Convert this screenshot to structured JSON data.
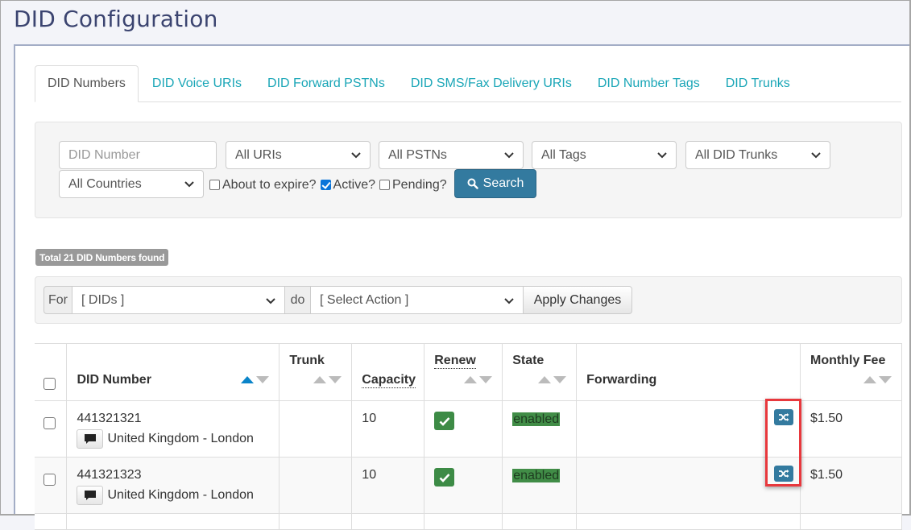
{
  "page": {
    "title": "DID Configuration"
  },
  "tabs": [
    {
      "label": "DID Numbers",
      "active": true
    },
    {
      "label": "DID Voice URIs",
      "active": false
    },
    {
      "label": "DID Forward PSTNs",
      "active": false
    },
    {
      "label": "DID SMS/Fax Delivery URIs",
      "active": false
    },
    {
      "label": "DID Number Tags",
      "active": false
    },
    {
      "label": "DID Trunks",
      "active": false
    }
  ],
  "filters": {
    "did_number_placeholder": "DID Number",
    "uris_selected": "All URIs",
    "pstns_selected": "All PSTNs",
    "tags_selected": "All Tags",
    "trunks_selected": "All DID Trunks",
    "countries_selected": "All Countries",
    "about_to_expire": {
      "label": "About to expire?",
      "checked": false
    },
    "active": {
      "label": "Active?",
      "checked": true
    },
    "pending": {
      "label": "Pending?",
      "checked": false
    },
    "search_label": "Search"
  },
  "summary": {
    "total_badge": "Total 21 DID Numbers found"
  },
  "bulk_action": {
    "for_label": "For",
    "target_selected": "[ DIDs ]",
    "do_label": "do",
    "action_selected": "[ Select Action ]",
    "apply_label": "Apply Changes"
  },
  "table": {
    "headers": {
      "did_number": "DID Number",
      "trunk": "Trunk",
      "capacity": "Capacity",
      "renew": "Renew",
      "state": "State",
      "forwarding": "Forwarding",
      "monthly_fee": "Monthly Fee"
    },
    "sort": {
      "column": "did_number",
      "direction": "asc"
    },
    "rows": [
      {
        "did": "441321321",
        "location": "United Kingdom - London",
        "trunk": "",
        "capacity": "10",
        "renew": true,
        "state": "enabled",
        "forwarding": "",
        "monthly_fee": "$1.50"
      },
      {
        "did": "441321323",
        "location": "United Kingdom - London",
        "trunk": "",
        "capacity": "10",
        "renew": true,
        "state": "enabled",
        "forwarding": "",
        "monthly_fee": "$1.50"
      }
    ]
  },
  "colors": {
    "title": "#3b4470",
    "tab_link": "#1aa6b7",
    "primary_button": "#337a9f",
    "success": "#3d8b46",
    "sort_active": "#0a84c9",
    "annotation_box": "#e8383d"
  }
}
